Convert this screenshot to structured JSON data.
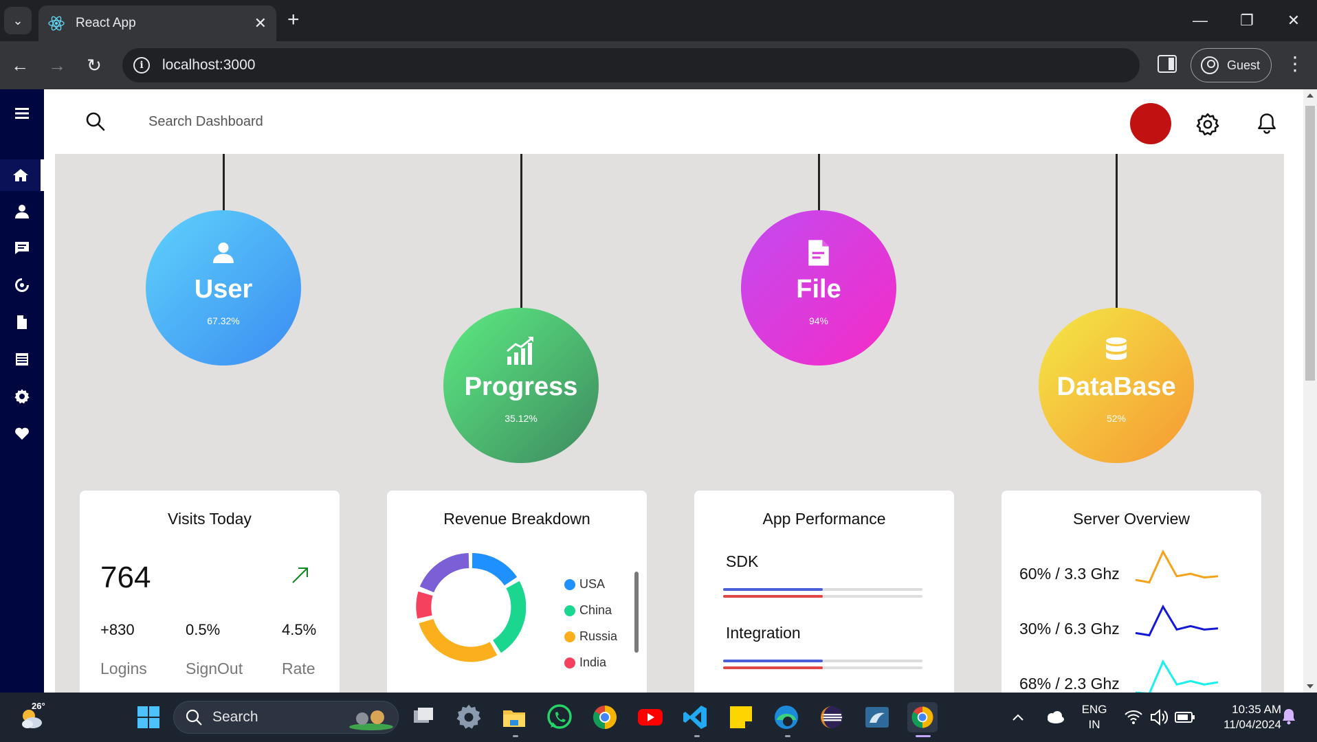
{
  "browser": {
    "tab_title": "React App",
    "url": "localhost:3000",
    "profile_label": "Guest"
  },
  "topbar": {
    "search_placeholder": "Search Dashboard"
  },
  "sidebar": {
    "items": [
      "menu-icon",
      "home-icon",
      "user-icon",
      "message-icon",
      "chart-cycle-icon",
      "document-icon",
      "list-icon",
      "gear-icon",
      "heart-icon"
    ],
    "active": "home-icon"
  },
  "hanging": [
    {
      "label": "User",
      "value": "67.32%",
      "icon": "user-icon",
      "colors": [
        "#5ed2fb",
        "#3b8cf2"
      ]
    },
    {
      "label": "Progress",
      "value": "35.12%",
      "icon": "growth-chart-icon",
      "colors": [
        "#5ceb82",
        "#3e8a5f"
      ]
    },
    {
      "label": "File",
      "value": "94%",
      "icon": "file-icon",
      "colors": [
        "#c24bf0",
        "#f52bc7"
      ]
    },
    {
      "label": "DataBase",
      "value": "52%",
      "icon": "database-icon",
      "colors": [
        "#f4e846",
        "#f69833"
      ]
    }
  ],
  "visits": {
    "title": "Visits Today",
    "count": "764",
    "stats": [
      {
        "value": "+830",
        "label": "Logins"
      },
      {
        "value": "0.5%",
        "label": "SignOut"
      },
      {
        "value": "4.5%",
        "label": "Rate"
      }
    ]
  },
  "revenue": {
    "title": "Revenue Breakdown",
    "legend": [
      {
        "name": "USA",
        "color": "#1e90ff"
      },
      {
        "name": "China",
        "color": "#1bd68f"
      },
      {
        "name": "Russia",
        "color": "#fbaf1c"
      },
      {
        "name": "India",
        "color": "#f5405e"
      }
    ]
  },
  "performance": {
    "title": "App Performance",
    "items": [
      {
        "label": "SDK",
        "bar1": 0.5,
        "bar2": 0.5
      },
      {
        "label": "Integration",
        "bar1": 0.5,
        "bar2": 0.5
      }
    ],
    "colors": {
      "bar1": "#4a5fd8",
      "bar2": "#e04848"
    }
  },
  "server": {
    "title": "Server Overview",
    "rows": [
      {
        "label": "60% / 3.3 Ghz",
        "color": "#f7a21b",
        "points": [
          5,
          3,
          28,
          8,
          10,
          7,
          8
        ]
      },
      {
        "label": "30% / 6.3 Ghz",
        "color": "#1419d6",
        "points": [
          7,
          5,
          30,
          10,
          13,
          10,
          11
        ]
      },
      {
        "label": "68% / 2.3 Ghz",
        "color": "#19f0f0",
        "points": [
          3,
          2,
          30,
          10,
          13,
          10,
          12
        ]
      }
    ]
  },
  "taskbar": {
    "temperature": "26°",
    "search_label": "Search",
    "lang_line1": "ENG",
    "lang_line2": "IN",
    "time": "10:35 AM",
    "date": "11/04/2024"
  }
}
